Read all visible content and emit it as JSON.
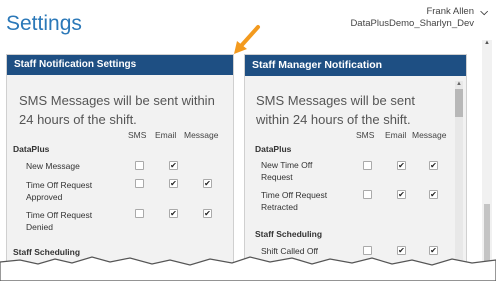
{
  "header": {
    "title": "Settings",
    "user_name": "Frank Allen",
    "org_name": "DataPlusDemo_Sharlyn_Dev"
  },
  "panels": {
    "left": {
      "title": "Staff Notification Settings",
      "intro": "SMS Messages will be sent within 24 hours of the shift.",
      "columns": [
        "SMS",
        "Email",
        "Message"
      ],
      "sections": [
        {
          "name": "DataPlus",
          "rows": [
            {
              "label": "New Message",
              "sms": false,
              "email": true,
              "message": null
            },
            {
              "label": "Time Off Request Approved",
              "sms": false,
              "email": true,
              "message": true
            },
            {
              "label": "Time Off Request Denied",
              "sms": false,
              "email": true,
              "message": true
            }
          ]
        },
        {
          "name": "Staff Scheduling",
          "rows": []
        }
      ]
    },
    "right": {
      "title": "Staff Manager Notification",
      "intro": "SMS Messages will be sent within 24 hours of the shift.",
      "columns": [
        "SMS",
        "Email",
        "Message"
      ],
      "sections": [
        {
          "name": "DataPlus",
          "rows": [
            {
              "label": "New Time Off Request",
              "sms": false,
              "email": true,
              "message": true
            },
            {
              "label": "Time Off Request Retracted",
              "sms": false,
              "email": true,
              "message": true
            }
          ]
        },
        {
          "name": "Staff Scheduling",
          "rows": [
            {
              "label": "Shift Called Off",
              "sms": false,
              "email": true,
              "message": true
            }
          ]
        }
      ]
    }
  },
  "icons": {
    "arrow": "orange-pointer-arrow",
    "chevron": "chevron-down-icon"
  },
  "colors": {
    "title": "#2b78b8",
    "panel_header": "#1e4f83",
    "arrow": "#f39a1e"
  }
}
